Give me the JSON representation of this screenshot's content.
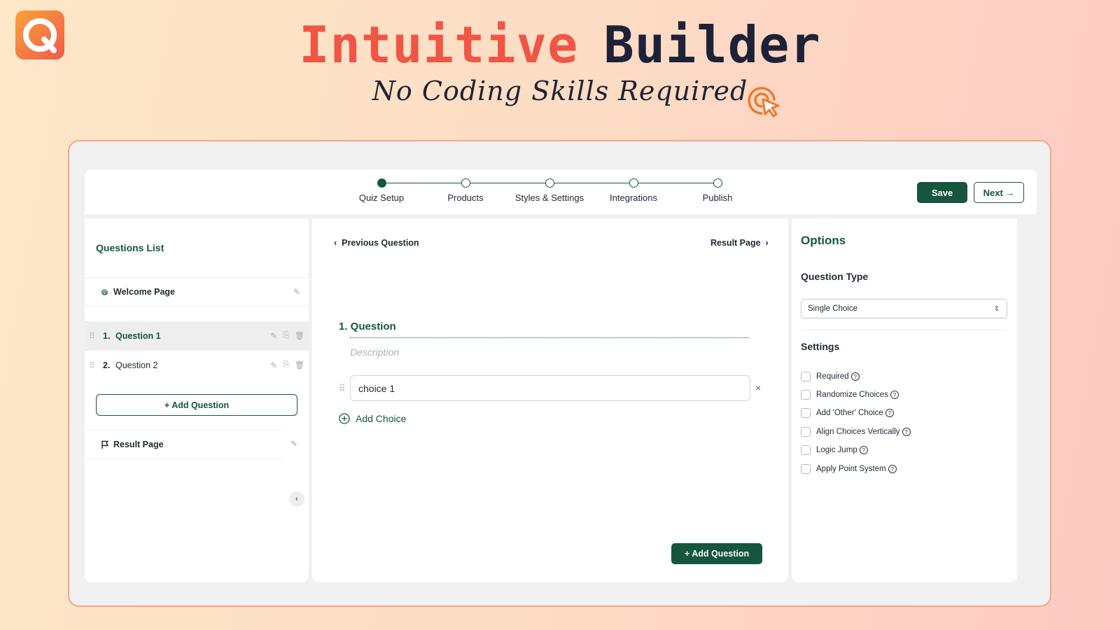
{
  "hero": {
    "title_word1": "Intuitive",
    "title_word2": "Builder",
    "subtitle": "No Coding Skills Required"
  },
  "colors": {
    "brand": "#15563d",
    "accent_red": "#f05545",
    "frame_border": "#f6a486"
  },
  "stepper": {
    "steps": [
      "Quiz Setup",
      "Products",
      "Styles & Settings",
      "Integrations",
      "Publish"
    ],
    "active_index": 0
  },
  "toolbar": {
    "save_label": "Save",
    "next_label": "Next"
  },
  "questions_list": {
    "title": "Questions List",
    "welcome_label": "Welcome Page",
    "questions": [
      {
        "num": "1.",
        "label": "Question 1"
      },
      {
        "num": "2.",
        "label": "Question 2"
      }
    ],
    "add_question_label": "Add Question",
    "result_label": "Result Page"
  },
  "editor": {
    "prev_label": "Previous Question",
    "next_label": "Result Page",
    "question_title": "1. Question",
    "description_placeholder": "Description",
    "choice_value": "choice 1",
    "add_choice_label": "Add Choice",
    "add_question_label": "Add Question"
  },
  "options": {
    "title": "Options",
    "question_type_label": "Question Type",
    "question_type_value": "Single Choice",
    "settings_label": "Settings",
    "settings": [
      "Required",
      "Randomize Choices",
      "Add 'Other' Choice",
      "Align Choices Vertically",
      "Logic Jump",
      "Apply Point System"
    ]
  }
}
